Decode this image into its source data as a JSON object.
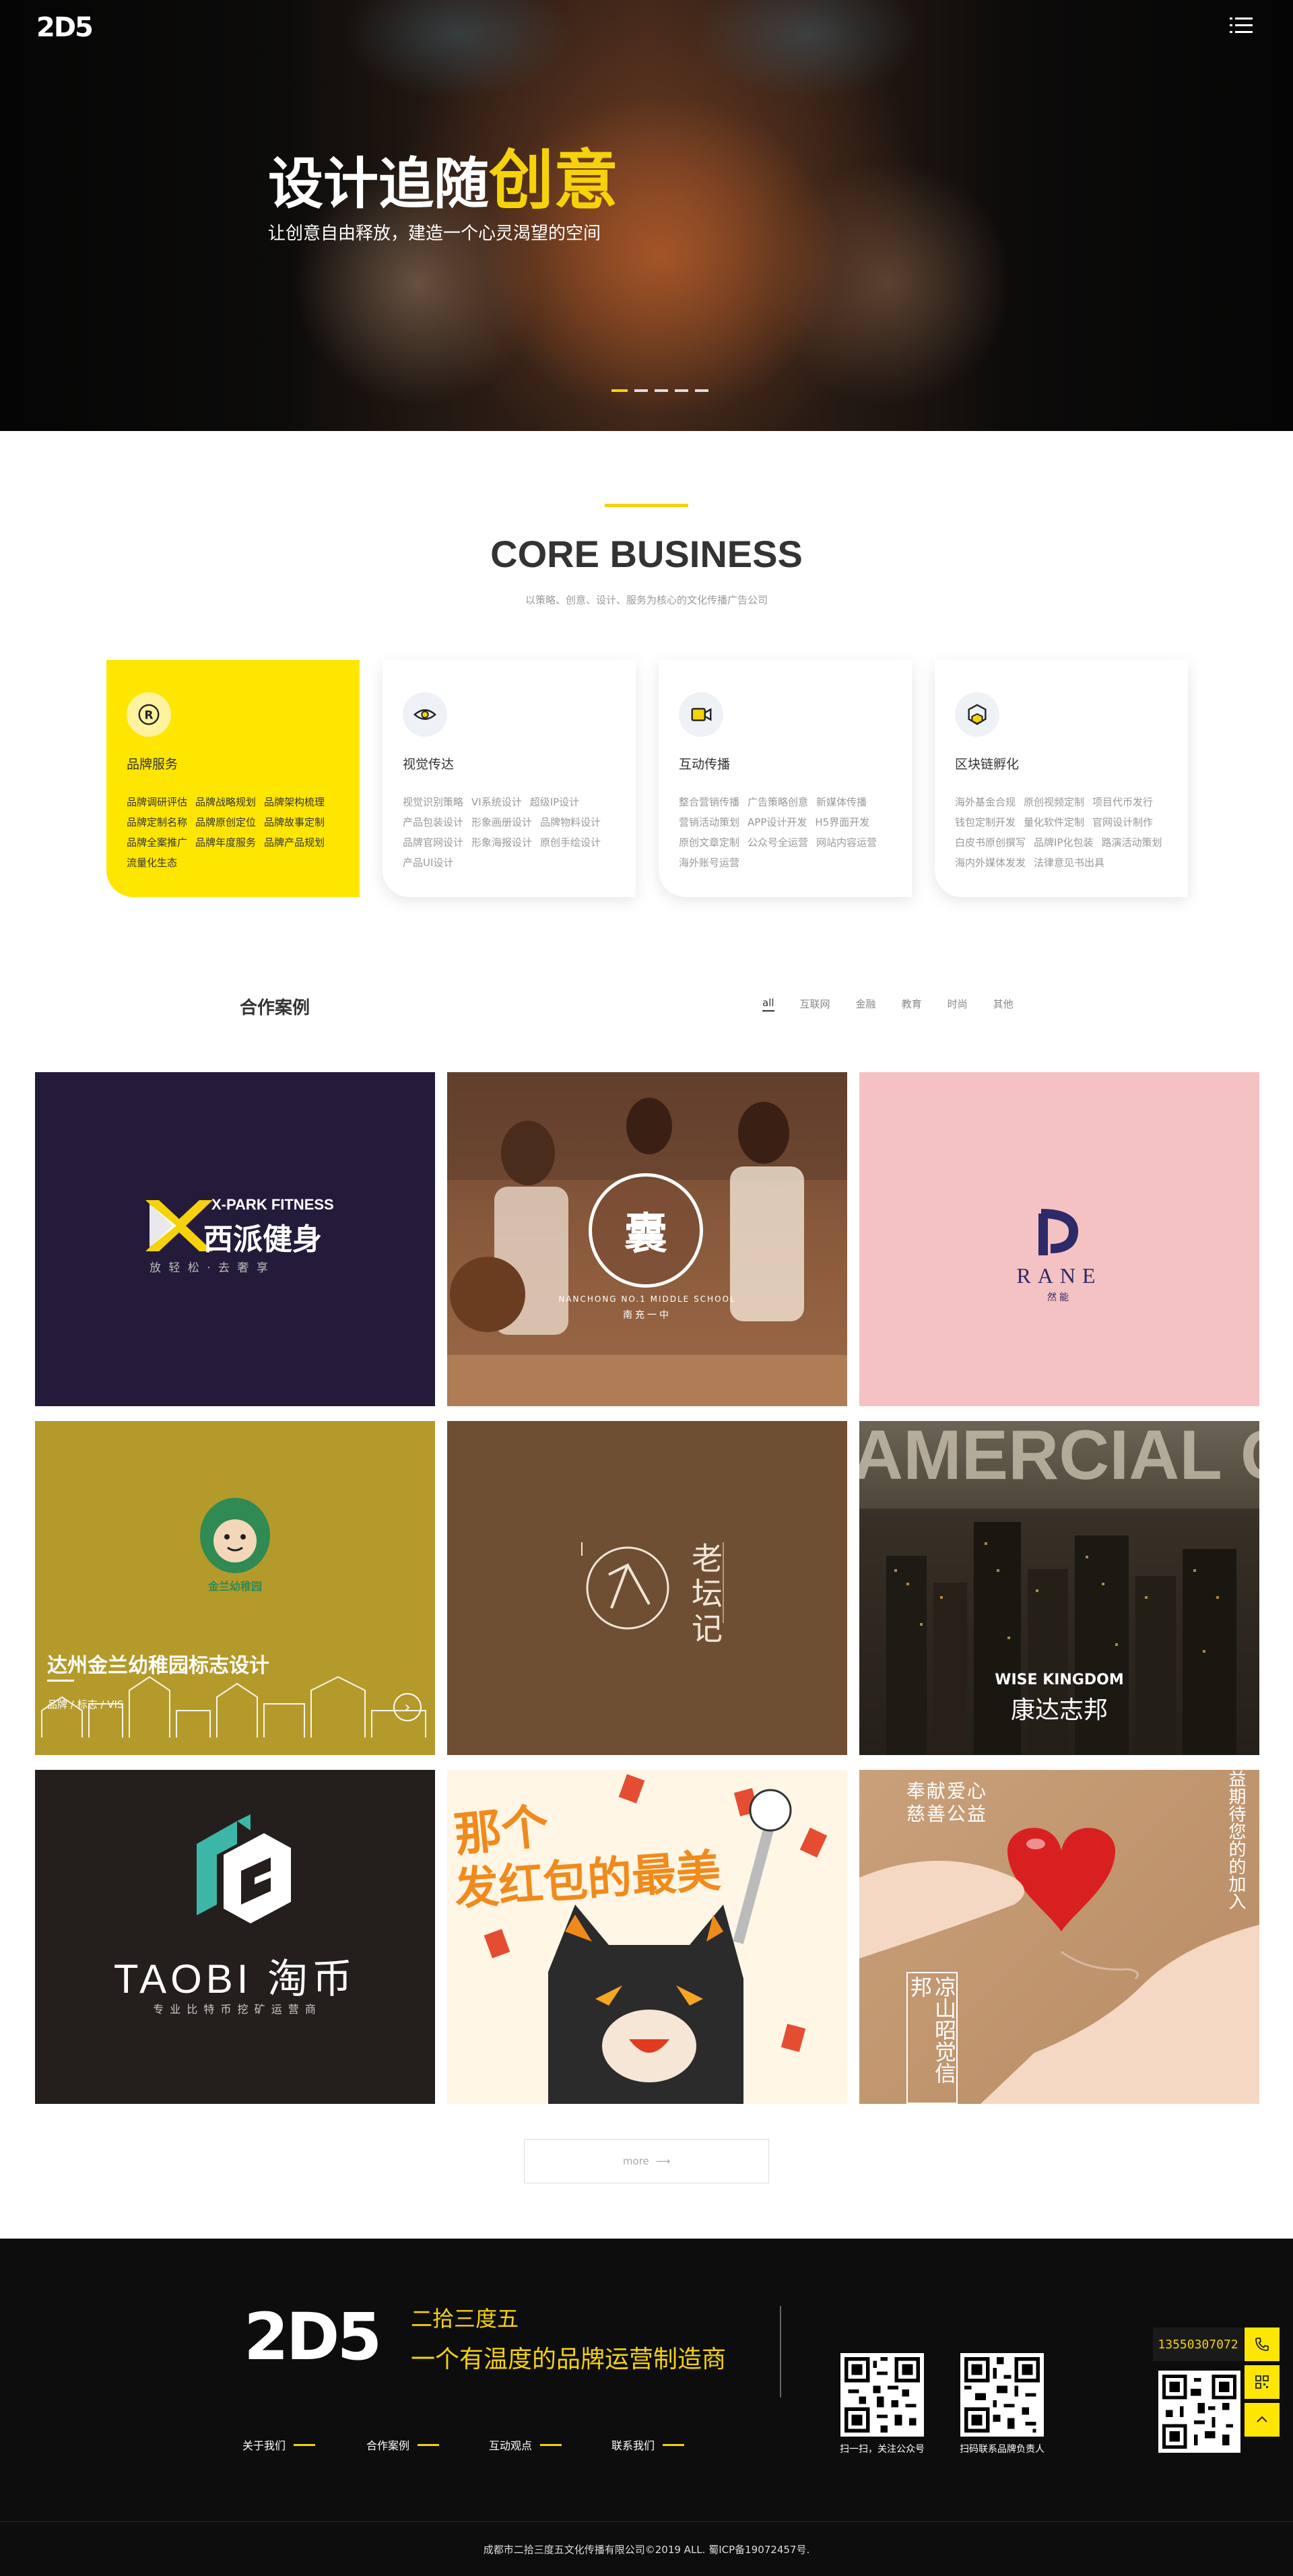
{
  "brand": {
    "logo_text": "2D5"
  },
  "hero": {
    "title_plain": "设计追随",
    "title_highlight": "创意",
    "subtitle": "让创意自由释放，建造一个心灵渴望的空间",
    "slide_count": 5,
    "active_slide": 1
  },
  "core": {
    "title": "CORE BUSINESS",
    "subtitle": "以策略、创意、设计、服务为核心的文化传播广告公司",
    "cards": [
      {
        "title": "品牌服务",
        "icon": "registered-icon",
        "active": true,
        "items": [
          "品牌调研评估",
          "品牌战略规划",
          "品牌架构梳理",
          "品牌定制名称",
          "品牌原创定位",
          "品牌故事定制",
          "品牌全案推广",
          "品牌年度服务",
          "品牌产品规划",
          "流量化生态"
        ]
      },
      {
        "title": "视觉传达",
        "icon": "eye-icon",
        "active": false,
        "items": [
          "视觉识别策略",
          "VI系统设计",
          "超级IP设计",
          "产品包装设计",
          "形象画册设计",
          "品牌物料设计",
          "品牌官网设计",
          "形象海报设计",
          "原创手绘设计",
          "产品UI设计"
        ]
      },
      {
        "title": "互动传播",
        "icon": "video-camera-icon",
        "active": false,
        "items": [
          "整合营销传播",
          "广告策略创意",
          "新媒体传播",
          "营销活动策划",
          "APP设计开发",
          "H5界面开发",
          "原创文章定制",
          "公众号全运营",
          "网站内容运营",
          "海外账号运营"
        ]
      },
      {
        "title": "区块链孵化",
        "icon": "blockchain-cube-icon",
        "active": false,
        "items": [
          "海外基金合规",
          "原创视频定制",
          "项目代币发行",
          "钱包定制开发",
          "量化软件定制",
          "官网设计制作",
          "白皮书原创撰写",
          "品牌IP化包装",
          "路演活动策划",
          "海内外媒体发发",
          "法律意见书出具"
        ]
      }
    ]
  },
  "cases": {
    "title": "合作案例",
    "filters": [
      "all",
      "互联网",
      "金融",
      "教育",
      "时尚",
      "其他"
    ],
    "active_filter": "all",
    "tiles": [
      {
        "brand_en": "X-PARK FITNESS",
        "brand_cn": "西派健身",
        "tagline": "放 轻 松 · 去 奢 享",
        "bg": "#241b3b"
      },
      {
        "brand_en": "NANCHONG NO.1 MIDDLE SCHOOL",
        "brand_cn": "南充一中",
        "seal": "囊",
        "bg": "#8a5a3c"
      },
      {
        "brand_en": "RANE",
        "brand_cn": "然能",
        "bg": "#f4c2c2"
      },
      {
        "brand_cn": "金兰幼稚园",
        "overlay_title": "达州金兰幼稚园标志设计",
        "overlay_tags": "品牌 / 标志 / VIS",
        "bg": "#b49a2b"
      },
      {
        "brand_cn": "老坛记",
        "bg": "#6f4f33"
      },
      {
        "banner": "AMERCIAL CENT",
        "brand_en": "WISE KINGDOM",
        "brand_cn": "康达志邦",
        "bg": "#3a3328"
      },
      {
        "brand_en": "TAOBI",
        "brand_cn": "淘币",
        "tagline": "专 业 比 特 币 挖 矿 运 营 商",
        "bg": "#241f1c"
      },
      {
        "headline_1": "那个",
        "headline_2": "发红包的最美",
        "bg": "#fff6e6"
      },
      {
        "corner_1": "奉献爱心",
        "corner_2": "慈善公益",
        "side_text": "益期待您的的加入",
        "vertical_text": "凉山昭觉信邦",
        "bg": "#c9a07a"
      }
    ],
    "more_label": "more"
  },
  "footer": {
    "logo_text": "2D5",
    "company_name": "二拾三度五",
    "slogan": "一个有温度的品牌运营制造商",
    "nav": [
      "关于我们",
      "合作案例",
      "互动观点",
      "联系我们"
    ],
    "qr_captions": [
      "扫一扫，关注公众号",
      "扫码联系品牌负责人"
    ],
    "copyright": "成都市二拾三度五文化传播有限公司©2019 ALL. 蜀ICP备19072457号."
  },
  "float": {
    "phone": "13550307072"
  },
  "colors": {
    "accent": "#f5d20c",
    "card_active": "#ffe600",
    "footer_bg": "#0d0d0d"
  }
}
